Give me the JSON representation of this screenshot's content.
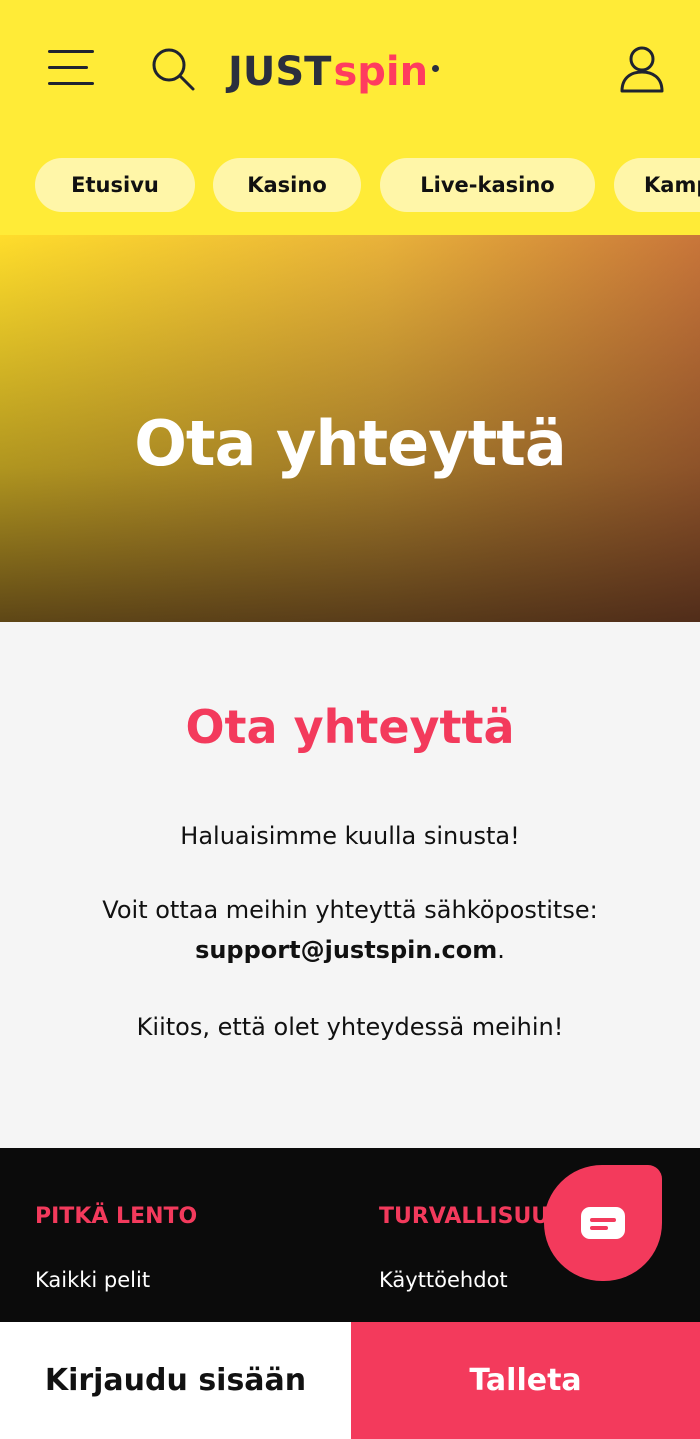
{
  "header": {
    "logo_just": "JUST",
    "logo_spin": "spin",
    "brand_colors": {
      "yellow": "#ffeb37",
      "pink": "#f33a5c",
      "navy": "#2b2f3e"
    }
  },
  "nav": {
    "items": [
      "Etusivu",
      "Kasino",
      "Live-kasino",
      "Kampanjat"
    ]
  },
  "hero": {
    "title": "Ota yhteyttä"
  },
  "content": {
    "heading": "Ota yhteyttä",
    "p1": "Haluaisimme kuulla sinusta!",
    "p2_prefix": "Voit ottaa meihin yhteyttä sähköpostitse:",
    "email": "support@justspin.com",
    "p2_suffix": ".",
    "p3": "Kiitos, että olet yhteydessä meihin!"
  },
  "footer": {
    "col1_heading": "PITKÄ LENTO",
    "col1_link": "Kaikki pelit",
    "col2_heading": "TURVALLISUUS",
    "col2_link": "Käyttöehdot"
  },
  "bottom_bar": {
    "login": "Kirjaudu sisään",
    "deposit": "Talleta"
  },
  "icons": [
    "menu-icon",
    "search-icon",
    "user-icon",
    "chat-icon"
  ]
}
